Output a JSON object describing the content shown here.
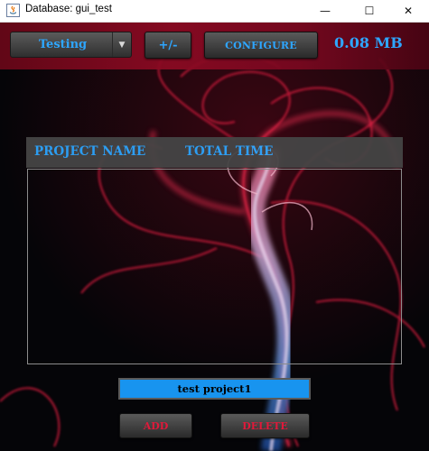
{
  "window": {
    "title": "Database: gui_test",
    "app_icon": "java-coffee-icon",
    "controls": {
      "minimize": "—",
      "maximize": "☐",
      "close": "✕"
    }
  },
  "toolbar": {
    "dropdown_value": "Testing",
    "dropdown_arrow": "▼",
    "plus_minus_label": "+/-",
    "configure_label": "CONFIGURE",
    "db_size": "0.08 MB"
  },
  "table": {
    "headers": [
      "PROJECT NAME",
      "TOTAL TIME"
    ],
    "rows": []
  },
  "project_name_field": {
    "value": "test project1"
  },
  "actions": {
    "add_label": "ADD",
    "delete_label": "DELETE"
  },
  "colors": {
    "accent_blue": "#2ea6ff",
    "action_red": "#e0193a",
    "topbar_red": "#8d0a23",
    "input_blue": "#1894ef"
  }
}
